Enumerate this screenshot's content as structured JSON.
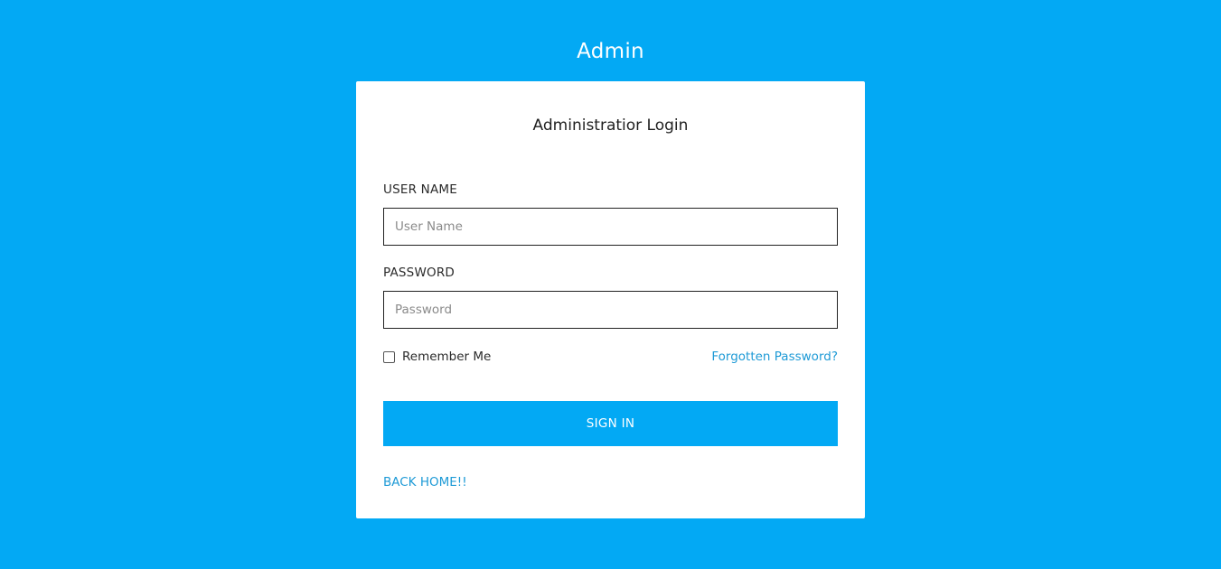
{
  "page": {
    "heading": "Admin",
    "background_color": "#03a9f4"
  },
  "login_card": {
    "title": "Administratior Login",
    "username": {
      "label": "USER NAME",
      "placeholder": "User Name",
      "value": ""
    },
    "password": {
      "label": "PASSWORD",
      "placeholder": "Password",
      "value": ""
    },
    "remember_me": {
      "label": "Remember Me",
      "checked": false
    },
    "forgot_password_label": "Forgotten Password?",
    "sign_in_label": "SIGN IN",
    "back_home_label": "BACK HOME!!",
    "link_color": "#1e9ad6",
    "button_color": "#03a9f4"
  }
}
